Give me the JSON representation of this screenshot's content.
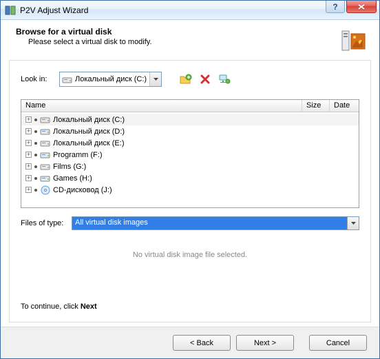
{
  "title": "P2V Adjust Wizard",
  "header": {
    "title": "Browse for a virtual disk",
    "subtitle": "Please select a virtual disk to modify."
  },
  "lookin": {
    "label": "Look in:",
    "value": "Локальный диск (C:)"
  },
  "toolbar": {
    "new_folder": "new-folder-icon",
    "delete": "delete-icon",
    "network": "network-icon"
  },
  "columns": {
    "name": "Name",
    "size": "Size",
    "date": "Date"
  },
  "drives": [
    {
      "label": "Локальный диск (C:)",
      "kind": "hdd",
      "selected": true
    },
    {
      "label": "Локальный диск (D:)",
      "kind": "hdd",
      "selected": false
    },
    {
      "label": "Локальный диск (E:)",
      "kind": "hdd",
      "selected": false
    },
    {
      "label": "Programm (F:)",
      "kind": "hdd",
      "selected": false
    },
    {
      "label": "Films (G:)",
      "kind": "hdd",
      "selected": false
    },
    {
      "label": "Games (H:)",
      "kind": "hdd",
      "selected": false
    },
    {
      "label": "CD-дисковод (J:)",
      "kind": "cd",
      "selected": false
    }
  ],
  "filetype": {
    "label": "Files of type:",
    "value": "All virtual disk images"
  },
  "status": "No virtual disk image file selected.",
  "continue": {
    "prefix": "To continue, click ",
    "bold": "Next"
  },
  "buttons": {
    "back": "< Back",
    "next": "Next >",
    "cancel": "Cancel"
  }
}
